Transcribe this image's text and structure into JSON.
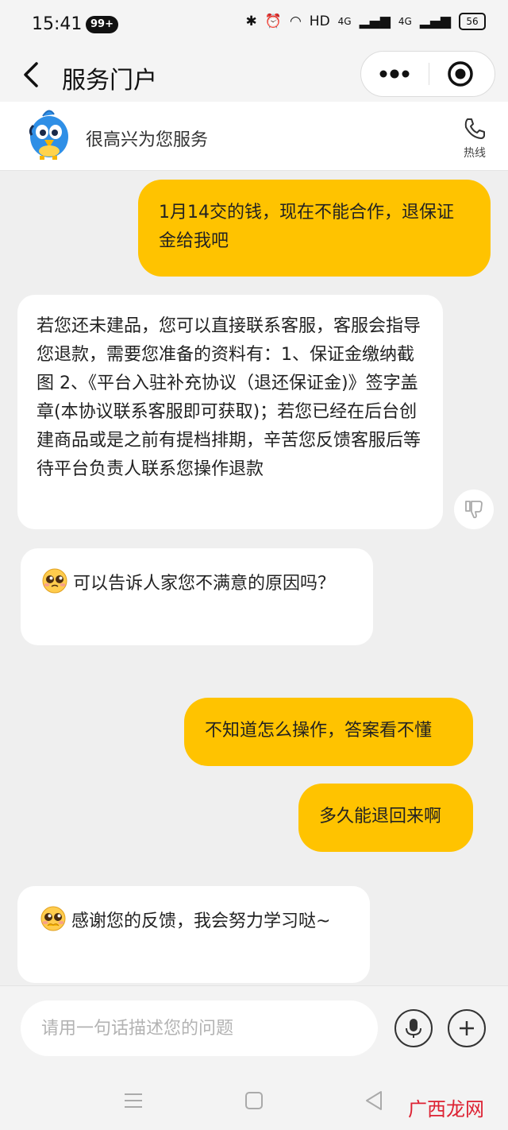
{
  "status_bar": {
    "time": "15:41",
    "badge": "99+",
    "network": "HD",
    "signal_1": "4G",
    "signal_2": "4G",
    "battery": "56"
  },
  "nav": {
    "title": "服务门户"
  },
  "service": {
    "greeting": "很高兴为您服务",
    "hotline_label": "热线"
  },
  "messages": [
    {
      "from": "user",
      "text": "1月14交的钱，现在不能合作，退保证金给我吧"
    },
    {
      "from": "bot",
      "text": "若您还未建品，您可以直接联系客服，客服会指导您退款，需要您准备的资料有：1、保证金缴纳截图 2、《平台入驻补充协议（退还保证金)》签字盖章(本协议联系客服即可获取)；若您已经在后台创建商品或是之前有提档排期，辛苦您反馈客服后等待平台负责人联系您操作退款"
    },
    {
      "from": "bot",
      "text": "可以告诉人家您不满意的原因吗？"
    },
    {
      "from": "user",
      "text": "不知道怎么操作，答案看不懂"
    },
    {
      "from": "user",
      "text": "多久能退回来啊"
    },
    {
      "from": "bot",
      "text": "感谢您的反馈，我会努力学习哒~"
    }
  ],
  "input": {
    "placeholder": "请用一句话描述您的问题"
  },
  "watermark": "广西龙网",
  "colors": {
    "user_bubble": "#ffc300",
    "bot_bubble": "#ffffff",
    "background": "#efefef"
  }
}
